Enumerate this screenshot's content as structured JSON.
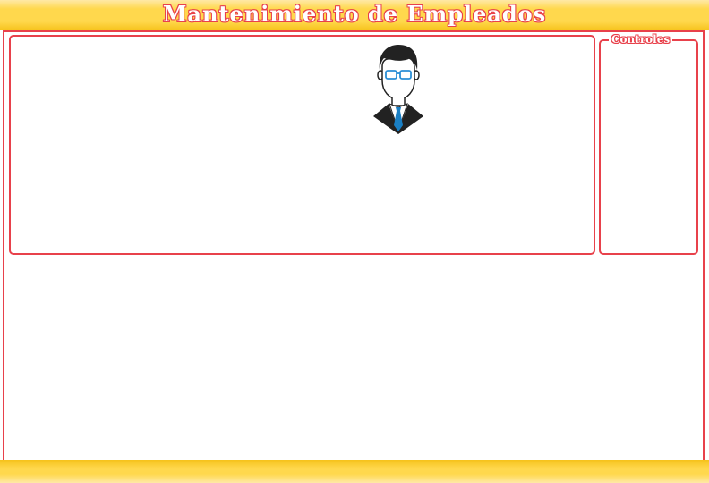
{
  "window": {
    "title": "Mantenimiento de Empleados"
  },
  "content_panel": {
    "avatar_icon": "employee-avatar-icon"
  },
  "controls_panel": {
    "legend": "Controles"
  },
  "colors": {
    "accent": "#e8414b",
    "banner": "#ffd84d",
    "tie": "#1a7fc4"
  }
}
